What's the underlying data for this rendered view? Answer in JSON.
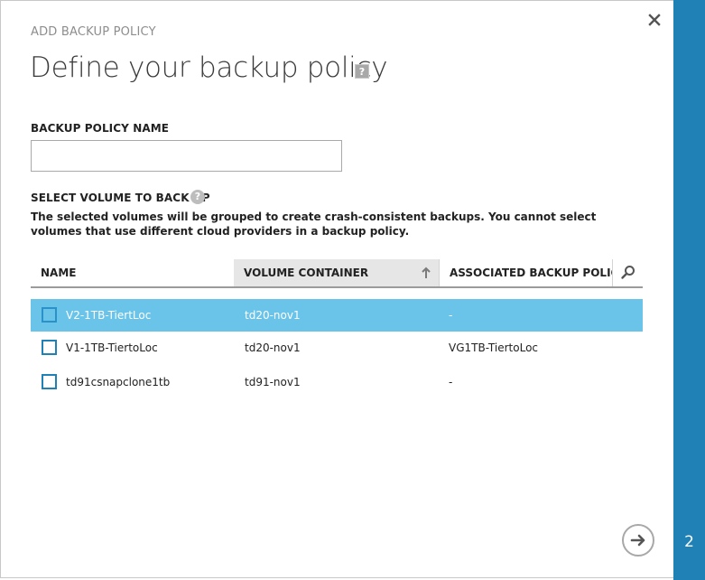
{
  "wizard": {
    "subtitle": "ADD BACKUP POLICY",
    "title": "Define your backup policy",
    "step_number": "2",
    "help_glyph": "?"
  },
  "form": {
    "policy_name_label": "BACKUP POLICY NAME",
    "policy_name_value": "",
    "policy_name_placeholder": "",
    "volume_section_label": "SELECT VOLUME TO BACK UP",
    "volume_description": "The selected volumes will be grouped to create crash-consistent backups. You cannot select volumes that use different cloud providers in a backup policy."
  },
  "table": {
    "columns": [
      {
        "label": "NAME"
      },
      {
        "label": "VOLUME CONTAINER",
        "sorted": "ascending"
      },
      {
        "label": "ASSOCIATED BACKUP POLICIES"
      }
    ],
    "rows": [
      {
        "name": "V2-1TB-TiertLoc",
        "container": "td20-nov1",
        "policies": "-",
        "selected": true,
        "checked": false
      },
      {
        "name": "V1-1TB-TiertoLoc",
        "container": "td20-nov1",
        "policies": "VG1TB-TiertoLoc",
        "selected": false,
        "checked": false
      },
      {
        "name": "td91csnapclone1tb",
        "container": "td91-nov1",
        "policies": "-",
        "selected": false,
        "checked": false
      }
    ]
  },
  "icons": {
    "close": "close-icon",
    "search": "search-icon",
    "sort": "sort-ascending-icon",
    "next": "arrow-right-icon",
    "help": "question-icon"
  },
  "colors": {
    "accent": "#1f81b6",
    "selected_row": "#6ac3e8"
  }
}
